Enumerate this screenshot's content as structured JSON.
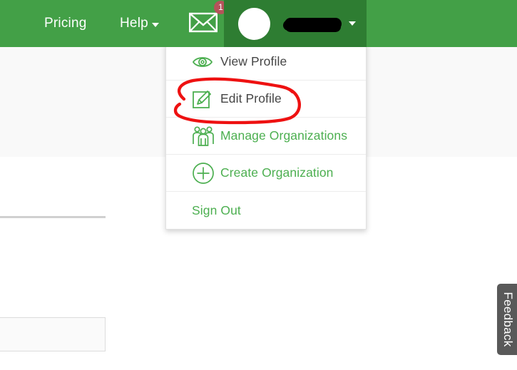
{
  "navbar": {
    "background_color": "#43a047",
    "active_item_color": "#2e7d32",
    "links": [
      {
        "label": "Pricing",
        "name": "nav-link-pricing",
        "has_caret": false
      },
      {
        "label": "Help",
        "name": "nav-link-help",
        "has_caret": true
      }
    ],
    "messages": {
      "icon": "envelope-icon",
      "badge_count": "1",
      "badge_color": "#b5535a"
    },
    "account": {
      "avatar": "user-avatar",
      "username": "",
      "username_redacted": true,
      "caret": "chevron-down-icon"
    }
  },
  "dropdown": {
    "name": "profile-dropdown",
    "items": [
      {
        "label": "View Profile",
        "icon": "eye-icon",
        "label_color": "#454545",
        "icon_color": "#4caf50"
      },
      {
        "label": "Edit Profile",
        "icon": "pencil-square-icon",
        "label_color": "#454545",
        "icon_color": "#4caf50"
      },
      {
        "label": "Manage Organizations",
        "icon": "people-group-icon",
        "label_color": "#4caf50",
        "icon_color": "#4caf50"
      },
      {
        "label": "Create Organization",
        "icon": "plus-circle-icon",
        "label_color": "#4caf50",
        "icon_color": "#4caf50"
      },
      {
        "label": "Sign Out",
        "icon": "",
        "label_color": "#4caf50",
        "icon_color": ""
      }
    ]
  },
  "annotation": {
    "name": "red-highlight-ellipse",
    "color": "#ee1111",
    "targets": "Edit Profile"
  },
  "feedback": {
    "label": "Feedback",
    "background_color": "#595959"
  }
}
